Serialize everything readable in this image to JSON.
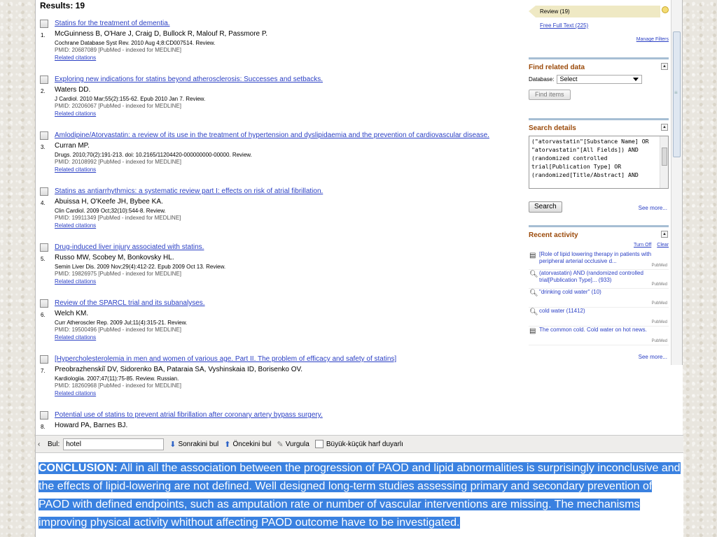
{
  "results": {
    "count_label": "Results: 19",
    "items": [
      {
        "num": "1.",
        "title": "Statins for the treatment of dementia.",
        "authors": "McGuinness B, O'Hare J, Craig D, Bullock R, Malouf R, Passmore P.",
        "cite": "Cochrane Database Syst Rev. 2010 Aug 4;8:CD007514. Review.",
        "pmid": "PMID: 20687089 [PubMed - indexed for MEDLINE]",
        "related": "Related citations"
      },
      {
        "num": "2.",
        "title": "Exploring new indications for statins beyond atherosclerosis: Successes and setbacks.",
        "authors": "Waters DD.",
        "cite": "J Cardiol. 2010 Mar;55(2):155-62. Epub 2010 Jan 7. Review.",
        "pmid": "PMID: 20206067 [PubMed - indexed for MEDLINE]",
        "related": "Related citations"
      },
      {
        "num": "3.",
        "title": "Amlodipine/Atorvastatin: a review of its use in the treatment of hypertension and dyslipidaemia and the prevention of cardiovascular disease.",
        "authors": "Curran MP.",
        "cite": "Drugs. 2010;70(2):191-213. doi: 10.2165/11204420-000000000-00000. Review.",
        "pmid": "PMID: 20108992 [PubMed - indexed for MEDLINE]",
        "related": "Related citations"
      },
      {
        "num": "4.",
        "title": "Statins as antiarrhythmics: a systematic review part I: effects on risk of atrial fibrillation.",
        "authors": "Abuissa H, O'Keefe JH, Bybee KA.",
        "cite": "Clin Cardiol. 2009 Oct;32(10):544-8. Review.",
        "pmid": "PMID: 19911349 [PubMed - indexed for MEDLINE]",
        "related": "Related citations"
      },
      {
        "num": "5.",
        "title": "Drug-induced liver injury associated with statins.",
        "authors": "Russo MW, Scobey M, Bonkovsky HL.",
        "cite": "Semin Liver Dis. 2009 Nov;29(4):412-22. Epub 2009 Oct 13. Review.",
        "pmid": "PMID: 19826975 [PubMed - indexed for MEDLINE]",
        "related": "Related citations"
      },
      {
        "num": "6.",
        "title": "Review of the SPARCL trial and its subanalyses.",
        "authors": "Welch KM.",
        "cite": "Curr Atheroscler Rep. 2009 Jul;11(4):315-21. Review.",
        "pmid": "PMID: 19500496 [PubMed - indexed for MEDLINE]",
        "related": "Related citations"
      },
      {
        "num": "7.",
        "title": "[Hypercholesterolemia in men and women of various age. Part II. The problem of efficacy and safety of statins]",
        "authors": "Preobrazhenskiĭ DV, Sidorenko BA, Pataraia SA, Vyshinskaia ID, Borisenko OV.",
        "cite": "Kardiologiia. 2007;47(11):75-85. Review. Russian.",
        "pmid": "PMID: 18260968 [PubMed - indexed for MEDLINE]",
        "related": "Related citations"
      },
      {
        "num": "8.",
        "title": "Potential use of statins to prevent atrial fibrillation after coronary artery bypass surgery.",
        "authors": "Howard PA, Barnes BJ.",
        "cite": "",
        "pmid": "",
        "related": ""
      }
    ]
  },
  "sidebar": {
    "review_filter": "Review (19)",
    "free_full_text": "Free Full Text (225)",
    "manage_filters": "Manage Filters",
    "find_related": {
      "heading": "Find related data",
      "database_label": "Database:",
      "database_value": "Select",
      "find_button": "Find items"
    },
    "search_details": {
      "heading": "Search details",
      "query": "(\"atorvastatin\"[Substance Name] OR \"atorvastatin\"[All Fields]) AND (randomized controlled trial[Publication Type] OR (randomized[Title/Abstract] AND",
      "search_button": "Search",
      "see_more": "See more..."
    },
    "recent_activity": {
      "heading": "Recent activity",
      "turn_off": "Turn Off",
      "clear": "Clear",
      "items": [
        {
          "icon": "document-icon",
          "text": "[Role of lipid lowering therapy in patients with peripheral arterial occlusive d...",
          "source": "PubMed"
        },
        {
          "icon": "search-icon",
          "text": "(atorvastatin) AND (randomized controlled trial[Publication Type]... (933)",
          "source": "PubMed"
        },
        {
          "icon": "search-icon",
          "text": "\"drinking cold water\" (10)",
          "source": "PubMed"
        },
        {
          "icon": "search-icon",
          "text": "cold water (11412)",
          "source": "PubMed"
        },
        {
          "icon": "document-icon",
          "text": "The common cold. Cold water on hot news.",
          "source": "PubMed"
        }
      ],
      "see_more": "See more..."
    }
  },
  "findbar": {
    "label": "Bul:",
    "value": "hotel",
    "next": "Sonrakini bul",
    "prev": "Öncekini bul",
    "highlight": "Vurgula",
    "match_case": "Büyük-küçük harf duyarlı"
  },
  "conclusion": {
    "label": "CONCLUSION:",
    "text": "All in all the association between the progression of PAOD and lipid abnormalities is surprisingly inconclusive and the effects of lipid-lowering are not defined. Well designed long-term studies assessing primary and secondary prevention of PAOD with defined endpoints, such as amputation rate or number of vascular interventions are missing. The mechanisms improving physical activity whithout affecting PAOD outcome have to be investigated."
  }
}
